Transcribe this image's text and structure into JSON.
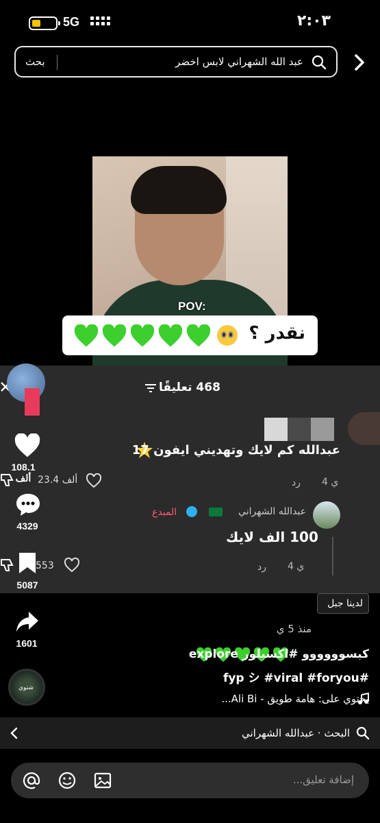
{
  "status_bar": {
    "network": "5G",
    "time": "٢:٠٣"
  },
  "search": {
    "query": "عبد الله الشهراني لابس اخضر",
    "button_label": "بحث"
  },
  "video": {
    "overlay_text": "POV:",
    "caption": "نقدر ؟"
  },
  "comments": {
    "count_label": "468 تعليقًا",
    "items": [
      {
        "text": "عبدالله كم لايك وتهديني ايفون 17",
        "time": "4 ي",
        "reply": "رد",
        "likes": "23.4 ألف"
      },
      {
        "author": "عبدالله الشهراني",
        "badge": "المبدع",
        "text": "100 الف لايك",
        "time": "4 ي",
        "reply": "رد",
        "likes": "553"
      }
    ]
  },
  "actions": {
    "likes": "108.1 ألف",
    "comments": "4329",
    "saves": "5087",
    "shares": "1601"
  },
  "tooltip": "لدينا جبل",
  "post": {
    "meta": "منذ 5 ي",
    "desc_line1": "كبسوووووو #اكسبلور explore",
    "desc_line2": "#fyp シ #viral #foryou",
    "music": "يحتوي على: هامة طويق - Ali Bi...",
    "avatar_label": "شتوي"
  },
  "related": {
    "text": "البحث · عبدالله الشهراني"
  },
  "compose": {
    "placeholder": "إضافة تعليق..."
  },
  "colors": {
    "heart_green": "#3ccf2e",
    "creator_pink": "#ff5a7a",
    "verified_blue": "#2fb0f0"
  }
}
